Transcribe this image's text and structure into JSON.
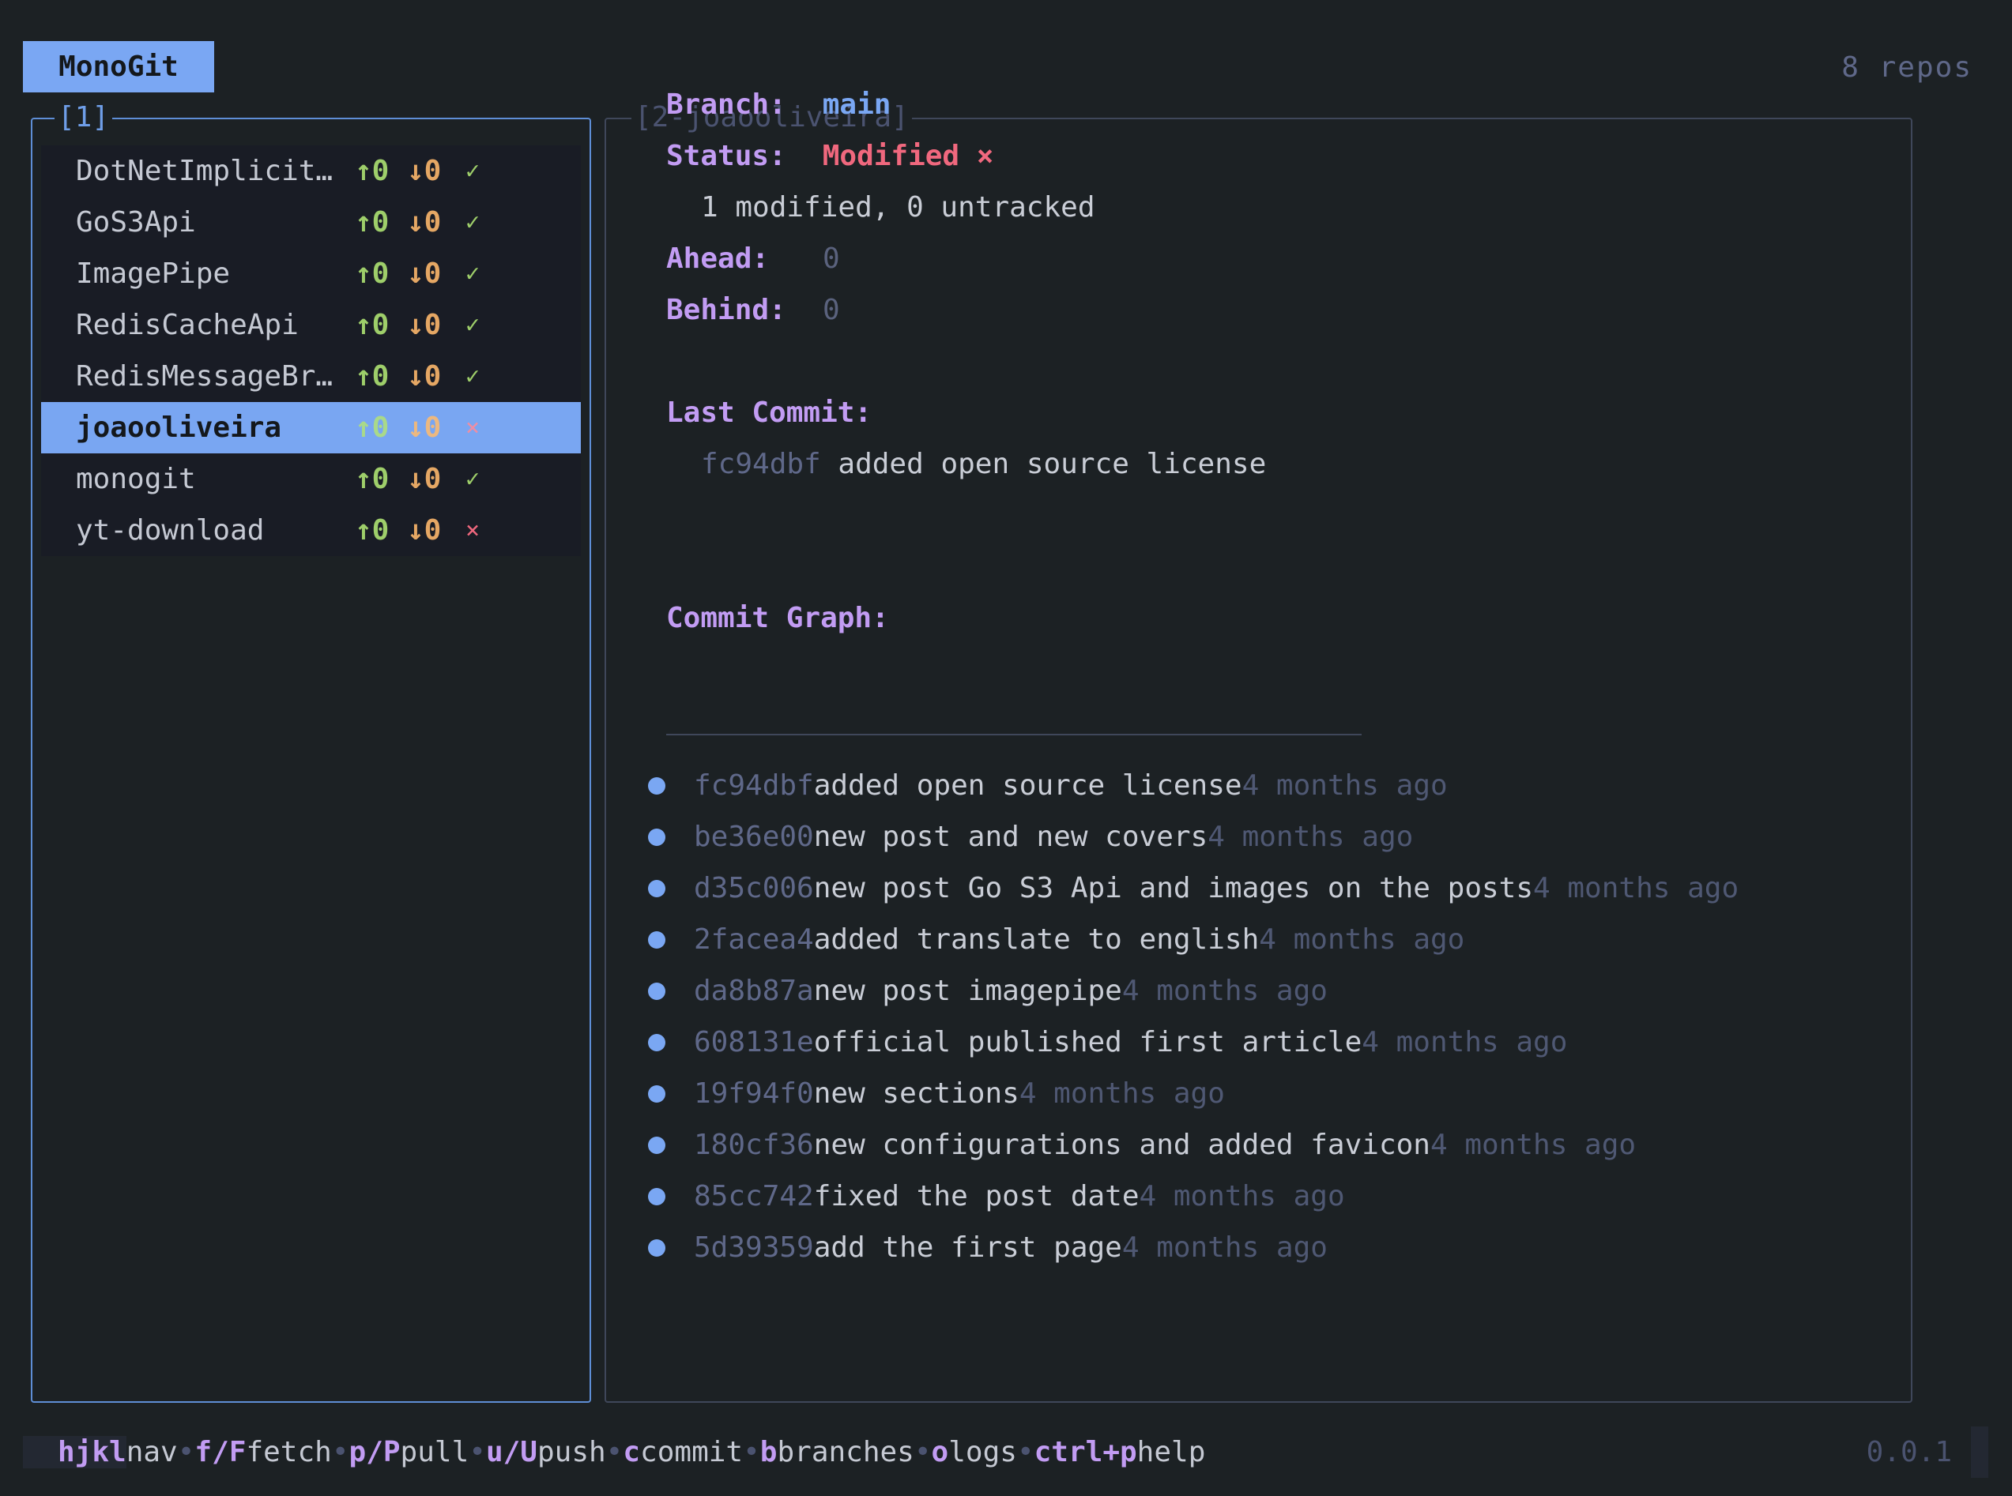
{
  "app": {
    "title": "MonoGit",
    "repo_count": "8 repos",
    "version": "0.0.1"
  },
  "left_panel": {
    "title": "[1]",
    "repos": [
      {
        "name": "DotNetImplicit…",
        "ahead": "↑0",
        "behind": "↓0",
        "status": "✓",
        "clean": true
      },
      {
        "name": "GoS3Api",
        "ahead": "↑0",
        "behind": "↓0",
        "status": "✓",
        "clean": true
      },
      {
        "name": "ImagePipe",
        "ahead": "↑0",
        "behind": "↓0",
        "status": "✓",
        "clean": true
      },
      {
        "name": "RedisCacheApi",
        "ahead": "↑0",
        "behind": "↓0",
        "status": "✓",
        "clean": true
      },
      {
        "name": "RedisMessageBr…",
        "ahead": "↑0",
        "behind": "↓0",
        "status": "✓",
        "clean": true
      },
      {
        "name": "joaooliveira",
        "ahead": "↑0",
        "behind": "↓0",
        "status": "×",
        "clean": false,
        "selected": true
      },
      {
        "name": "monogit",
        "ahead": "↑0",
        "behind": "↓0",
        "status": "✓",
        "clean": true
      },
      {
        "name": "yt-download",
        "ahead": "↑0",
        "behind": "↓0",
        "status": "×",
        "clean": false
      }
    ]
  },
  "right_panel": {
    "title": "[2-joaooliveira]",
    "branch_label": "Branch:",
    "branch_value": "main",
    "status_label": "Status:",
    "status_value": "Modified ×",
    "status_detail": "1 modified, 0 untracked",
    "ahead_label": "Ahead:",
    "ahead_value": "0",
    "behind_label": "Behind:",
    "behind_value": "0",
    "last_commit_label": "Last Commit:",
    "last_commit_hash": "fc94dbf",
    "last_commit_msg": "added open source license",
    "graph_label": "Commit Graph:",
    "commits": [
      {
        "hash": "fc94dbf",
        "msg": "added open source license",
        "time": "4 months ago"
      },
      {
        "hash": "be36e00",
        "msg": "new post and new covers",
        "time": "4 months ago"
      },
      {
        "hash": "d35c006",
        "msg": "new post Go S3 Api and images on the posts",
        "time": "4 months ago"
      },
      {
        "hash": "2facea4",
        "msg": "added translate to english",
        "time": "4 months ago"
      },
      {
        "hash": "da8b87a",
        "msg": "new post imagepipe",
        "time": "4 months ago"
      },
      {
        "hash": "608131e",
        "msg": "official published first article",
        "time": "4 months ago"
      },
      {
        "hash": "19f94f0",
        "msg": "new sections",
        "time": "4 months ago"
      },
      {
        "hash": "180cf36",
        "msg": "new configurations and added favicon",
        "time": "4 months ago"
      },
      {
        "hash": "85cc742",
        "msg": "fixed the post date",
        "time": "4 months ago"
      },
      {
        "hash": "5d39359",
        "msg": "add the first page",
        "time": "4 months ago"
      }
    ]
  },
  "footer": {
    "keys": [
      {
        "key": "hjkl",
        "desc": "nav"
      },
      {
        "key": "f/F",
        "desc": "fetch"
      },
      {
        "key": "p/P",
        "desc": "pull"
      },
      {
        "key": "u/U",
        "desc": "push"
      },
      {
        "key": "c",
        "desc": "commit"
      },
      {
        "key": "b",
        "desc": "branches"
      },
      {
        "key": "o",
        "desc": "logs"
      },
      {
        "key": "ctrl+p",
        "desc": "help"
      }
    ],
    "separator": "•"
  },
  "colors": {
    "accent": "#7aa7f3",
    "label": "#c29cf3",
    "ok": "#9ece6a",
    "warn": "#e5a764",
    "error": "#f0687e",
    "background": "#1c2124"
  }
}
